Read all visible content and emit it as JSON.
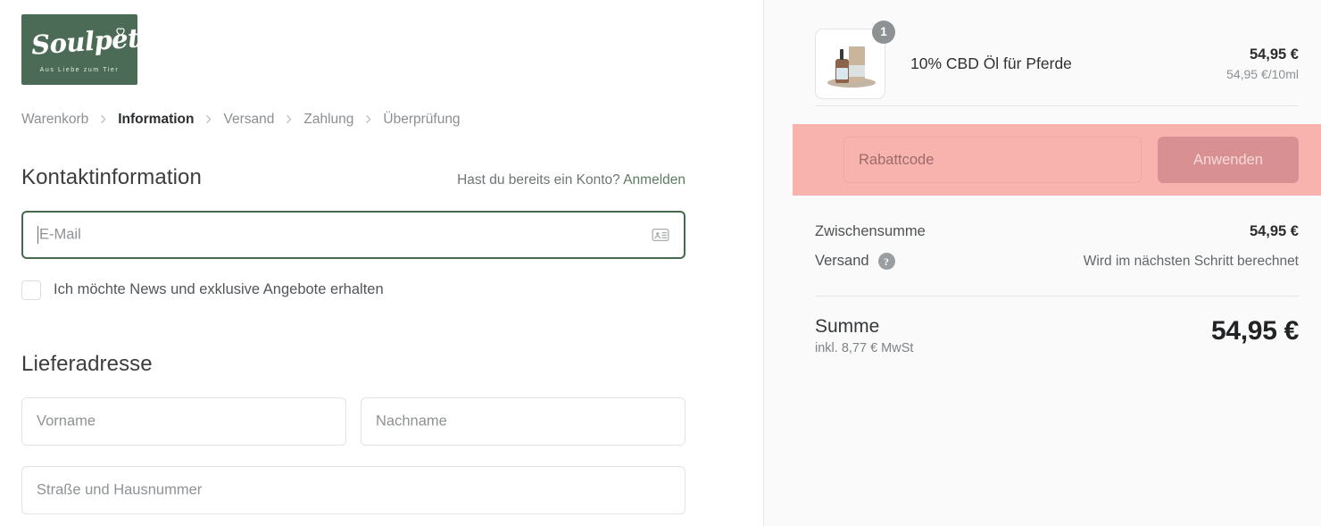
{
  "brand": {
    "name": "Soulpets",
    "tagline": "Aus Liebe zum Tier",
    "logo_bg": "#4c6b56",
    "accent_green": "#44694f"
  },
  "breadcrumb": {
    "separator_icon": "chevron-right-icon",
    "items": [
      {
        "label": "Warenkorb",
        "active": false
      },
      {
        "label": "Information",
        "active": true
      },
      {
        "label": "Versand",
        "active": false
      },
      {
        "label": "Zahlung",
        "active": false
      },
      {
        "label": "Überprüfung",
        "active": false
      }
    ]
  },
  "contact": {
    "title": "Kontaktinformation",
    "account_prompt": "Hast du bereits ein Konto?",
    "account_link": "Anmelden",
    "email_placeholder": "E-Mail",
    "email_value": "",
    "email_icon": "contact-card-icon",
    "newsletter_label": "Ich möchte News und exklusive Angebote erhalten",
    "newsletter_checked": false
  },
  "shipping_address": {
    "title": "Lieferadresse",
    "fields": [
      {
        "name": "first-name",
        "placeholder": "Vorname",
        "value": ""
      },
      {
        "name": "last-name",
        "placeholder": "Nachname",
        "value": ""
      },
      {
        "name": "street",
        "placeholder": "Straße und Hausnummer",
        "value": ""
      }
    ]
  },
  "order_summary": {
    "product": {
      "name": "10% CBD Öl für Pferde",
      "quantity": "1",
      "price": "54,95 €",
      "unit_price": "54,95 €/10ml",
      "image_alt": "cbd-oil-bottle-and-box"
    },
    "discount": {
      "placeholder": "Rabattcode",
      "value": "",
      "button_label": "Anwenden",
      "highlight_bg": "#f8b3ae",
      "button_bg": "#d99092"
    },
    "subtotal": {
      "label": "Zwischensumme",
      "value": "54,95 €"
    },
    "shipping": {
      "label": "Versand",
      "help_icon": "question-mark-icon",
      "value": "Wird im nächsten Schritt berechnet"
    },
    "total": {
      "label": "Summe",
      "tax_note": "inkl. 8,77 € MwSt",
      "value": "54,95 €"
    }
  }
}
